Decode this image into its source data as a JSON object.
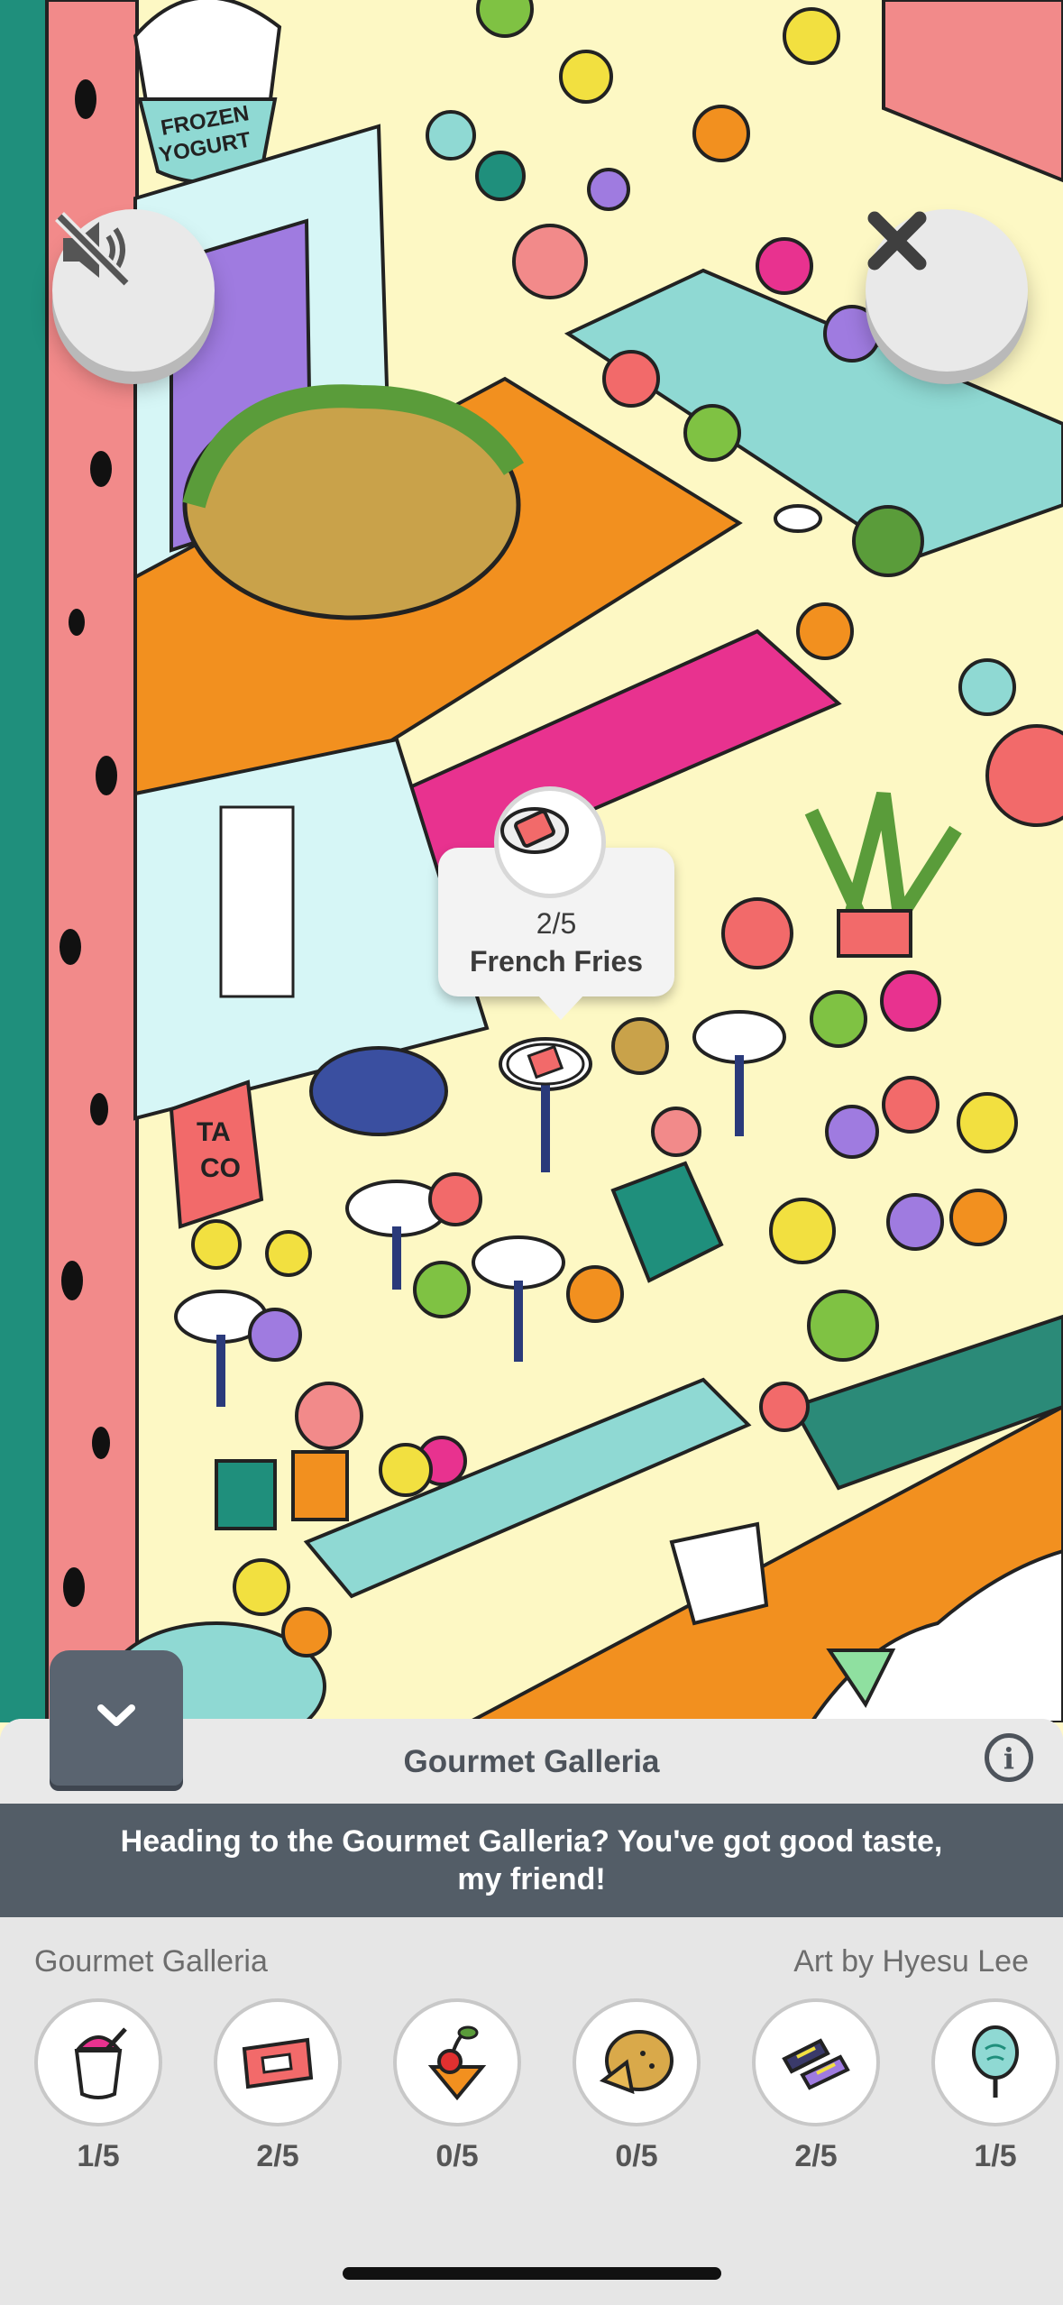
{
  "scene": {
    "cup_label_line1": "FROZEN",
    "cup_label_line2": "YOGURT",
    "sign_label_line1": "TA",
    "sign_label_line2": "CO"
  },
  "controls": {
    "mute_icon": "speaker-muted-icon",
    "close_icon": "close-icon",
    "collapse_icon": "chevron-down-icon"
  },
  "tooltip": {
    "count": "2/5",
    "name": "French Fries",
    "icon": "french-fries-icon"
  },
  "panel": {
    "title": "Gourmet Galleria",
    "info_icon": "i",
    "banner": "Heading to the Gourmet Galleria? You've got good taste, my friend!",
    "level_name": "Gourmet Galleria",
    "art_credit": "Art by Hyesu Lee",
    "items": [
      {
        "icon": "frozen-yogurt-icon",
        "count": "1/5"
      },
      {
        "icon": "french-fries-icon",
        "count": "2/5"
      },
      {
        "icon": "cherry-drink-icon",
        "count": "0/5"
      },
      {
        "icon": "pie-icon",
        "count": "0/5"
      },
      {
        "icon": "sushi-icon",
        "count": "2/5"
      },
      {
        "icon": "cotton-candy-icon",
        "count": "1/5"
      }
    ]
  },
  "colors": {
    "ground": "#fdf8c4",
    "pink_wall": "#f28a8a",
    "teal": "#1f8f7c",
    "orange": "#f2901f",
    "magenta": "#e8328f",
    "mint": "#8fd9d3",
    "panel_dark": "#535d67"
  }
}
